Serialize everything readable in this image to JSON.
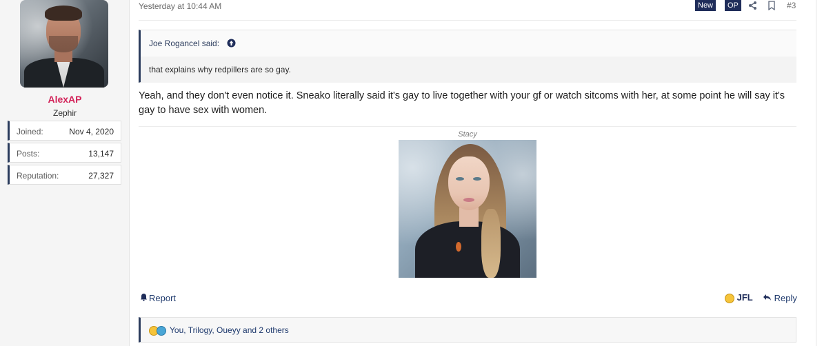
{
  "user": {
    "name": "AlexAP",
    "title": "Zephir",
    "stats": [
      {
        "label": "Joined:",
        "value": "Nov 4, 2020"
      },
      {
        "label": "Posts:",
        "value": "13,147"
      },
      {
        "label": "Reputation:",
        "value": "27,327"
      }
    ]
  },
  "post": {
    "date": "Yesterday at 10:44 AM",
    "tags": [
      "New",
      "OP"
    ],
    "number": "#3",
    "quote": {
      "author": "Joe Rogancel said:",
      "text": "that explains why redpillers are so gay."
    },
    "message": "Yeah, and they don't even notice it. Sneako literally said it's gay to live together with your gf or watch sitcoms with her, at some point he will say it's gay to have sex with women.",
    "image_caption": "Stacy"
  },
  "actions": {
    "report": "Report",
    "reaction": "JFL",
    "reply": "Reply"
  },
  "reactions": {
    "text": "You, Trilogy, Oueyy and 2 others"
  },
  "colors": {
    "accent": "#1f2d5a",
    "username": "#d3245a"
  }
}
